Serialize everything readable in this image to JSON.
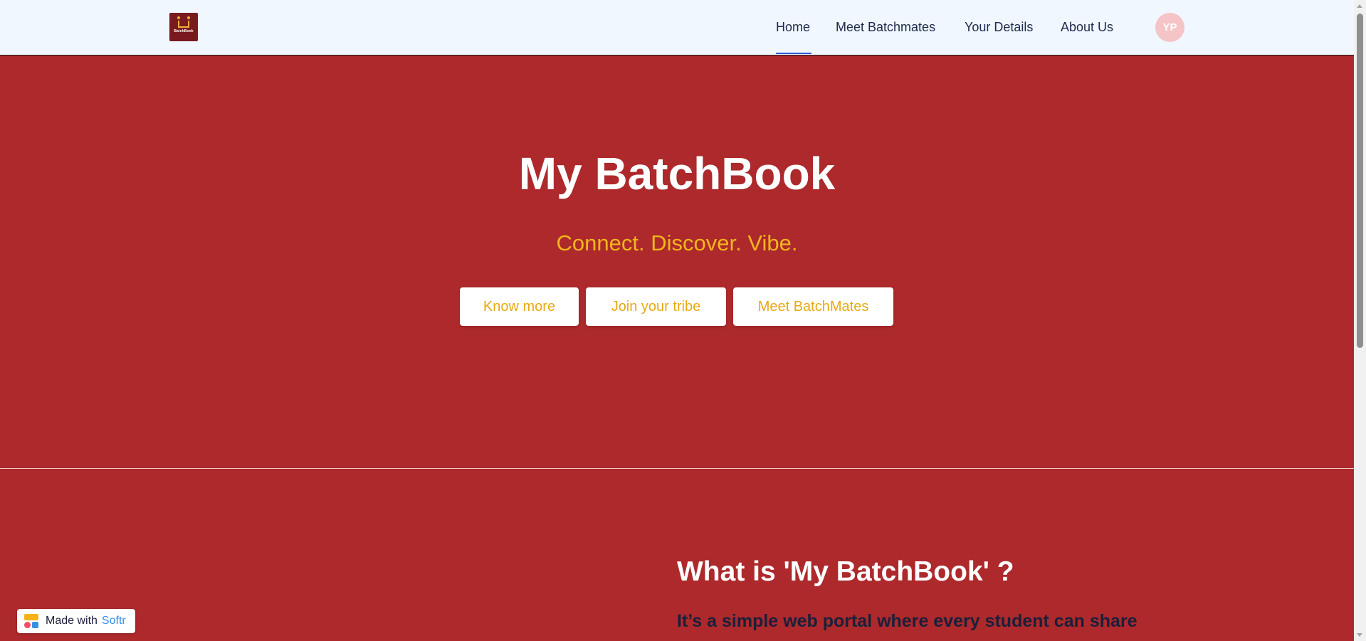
{
  "header": {
    "logo_text": "BatchBook",
    "nav": [
      {
        "label": "Home",
        "active": true
      },
      {
        "label": "Meet Batchmates",
        "active": false
      },
      {
        "label": "Your Details",
        "active": false
      },
      {
        "label": "About Us",
        "active": false
      }
    ],
    "avatar_initials": "YP"
  },
  "hero": {
    "title": "My BatchBook",
    "subtitle": "Connect. Discover. Vibe.",
    "buttons": [
      {
        "label": "Know more"
      },
      {
        "label": "Join your tribe"
      },
      {
        "label": "Meet BatchMates"
      }
    ]
  },
  "about": {
    "title": "What is 'My BatchBook' ?",
    "text": "It’s a simple web portal where every student can share"
  },
  "badge": {
    "prefix": "Made with",
    "brand": "Softr"
  },
  "colors": {
    "background": "#ad292b",
    "header_bg": "#f1f7fe",
    "accent_yellow": "#f2b51d",
    "nav_active_underline": "#2b5cd6",
    "avatar_bg": "#f5c4c7"
  },
  "icons": {
    "logo": "batchbook-logo",
    "badge_logo": "softr-logo-icon"
  }
}
